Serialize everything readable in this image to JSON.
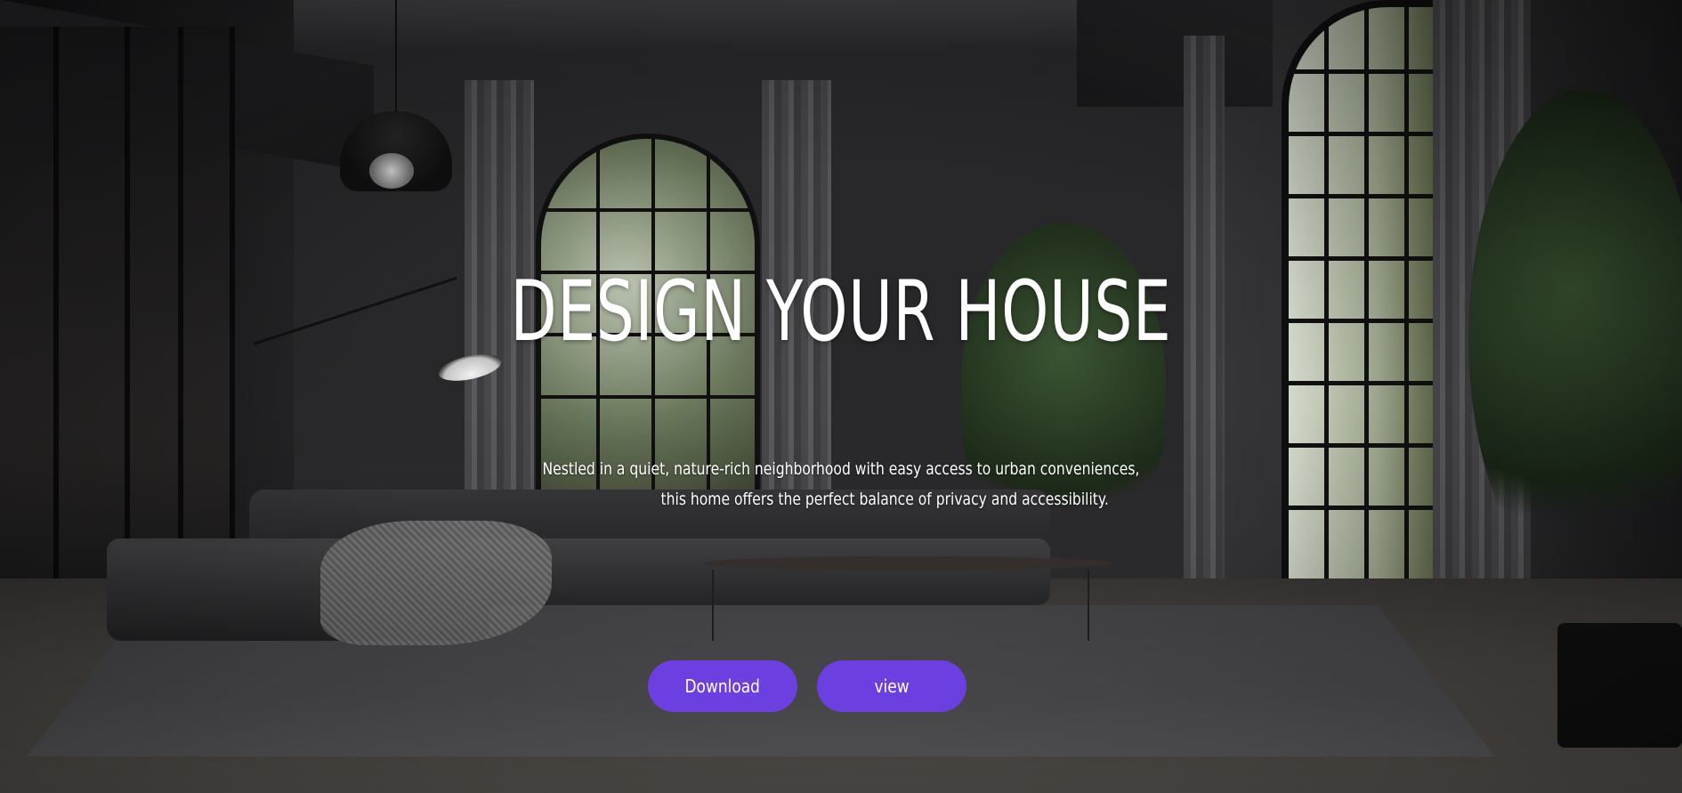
{
  "hero": {
    "headline": "DESIGN YOUR HOUSE",
    "description_line1": "Nestled in a quiet, nature-rich neighborhood with easy access to urban conveniences,",
    "description_line2": "this home offers the perfect balance of privacy and accessibility."
  },
  "actions": {
    "download_label": "Download",
    "view_label": "view"
  },
  "colors": {
    "accent": "#6c3fe0",
    "text": "#ffffff",
    "background": "#2a2a2c"
  },
  "background_image": {
    "subject": "dark-modern-living-room"
  }
}
